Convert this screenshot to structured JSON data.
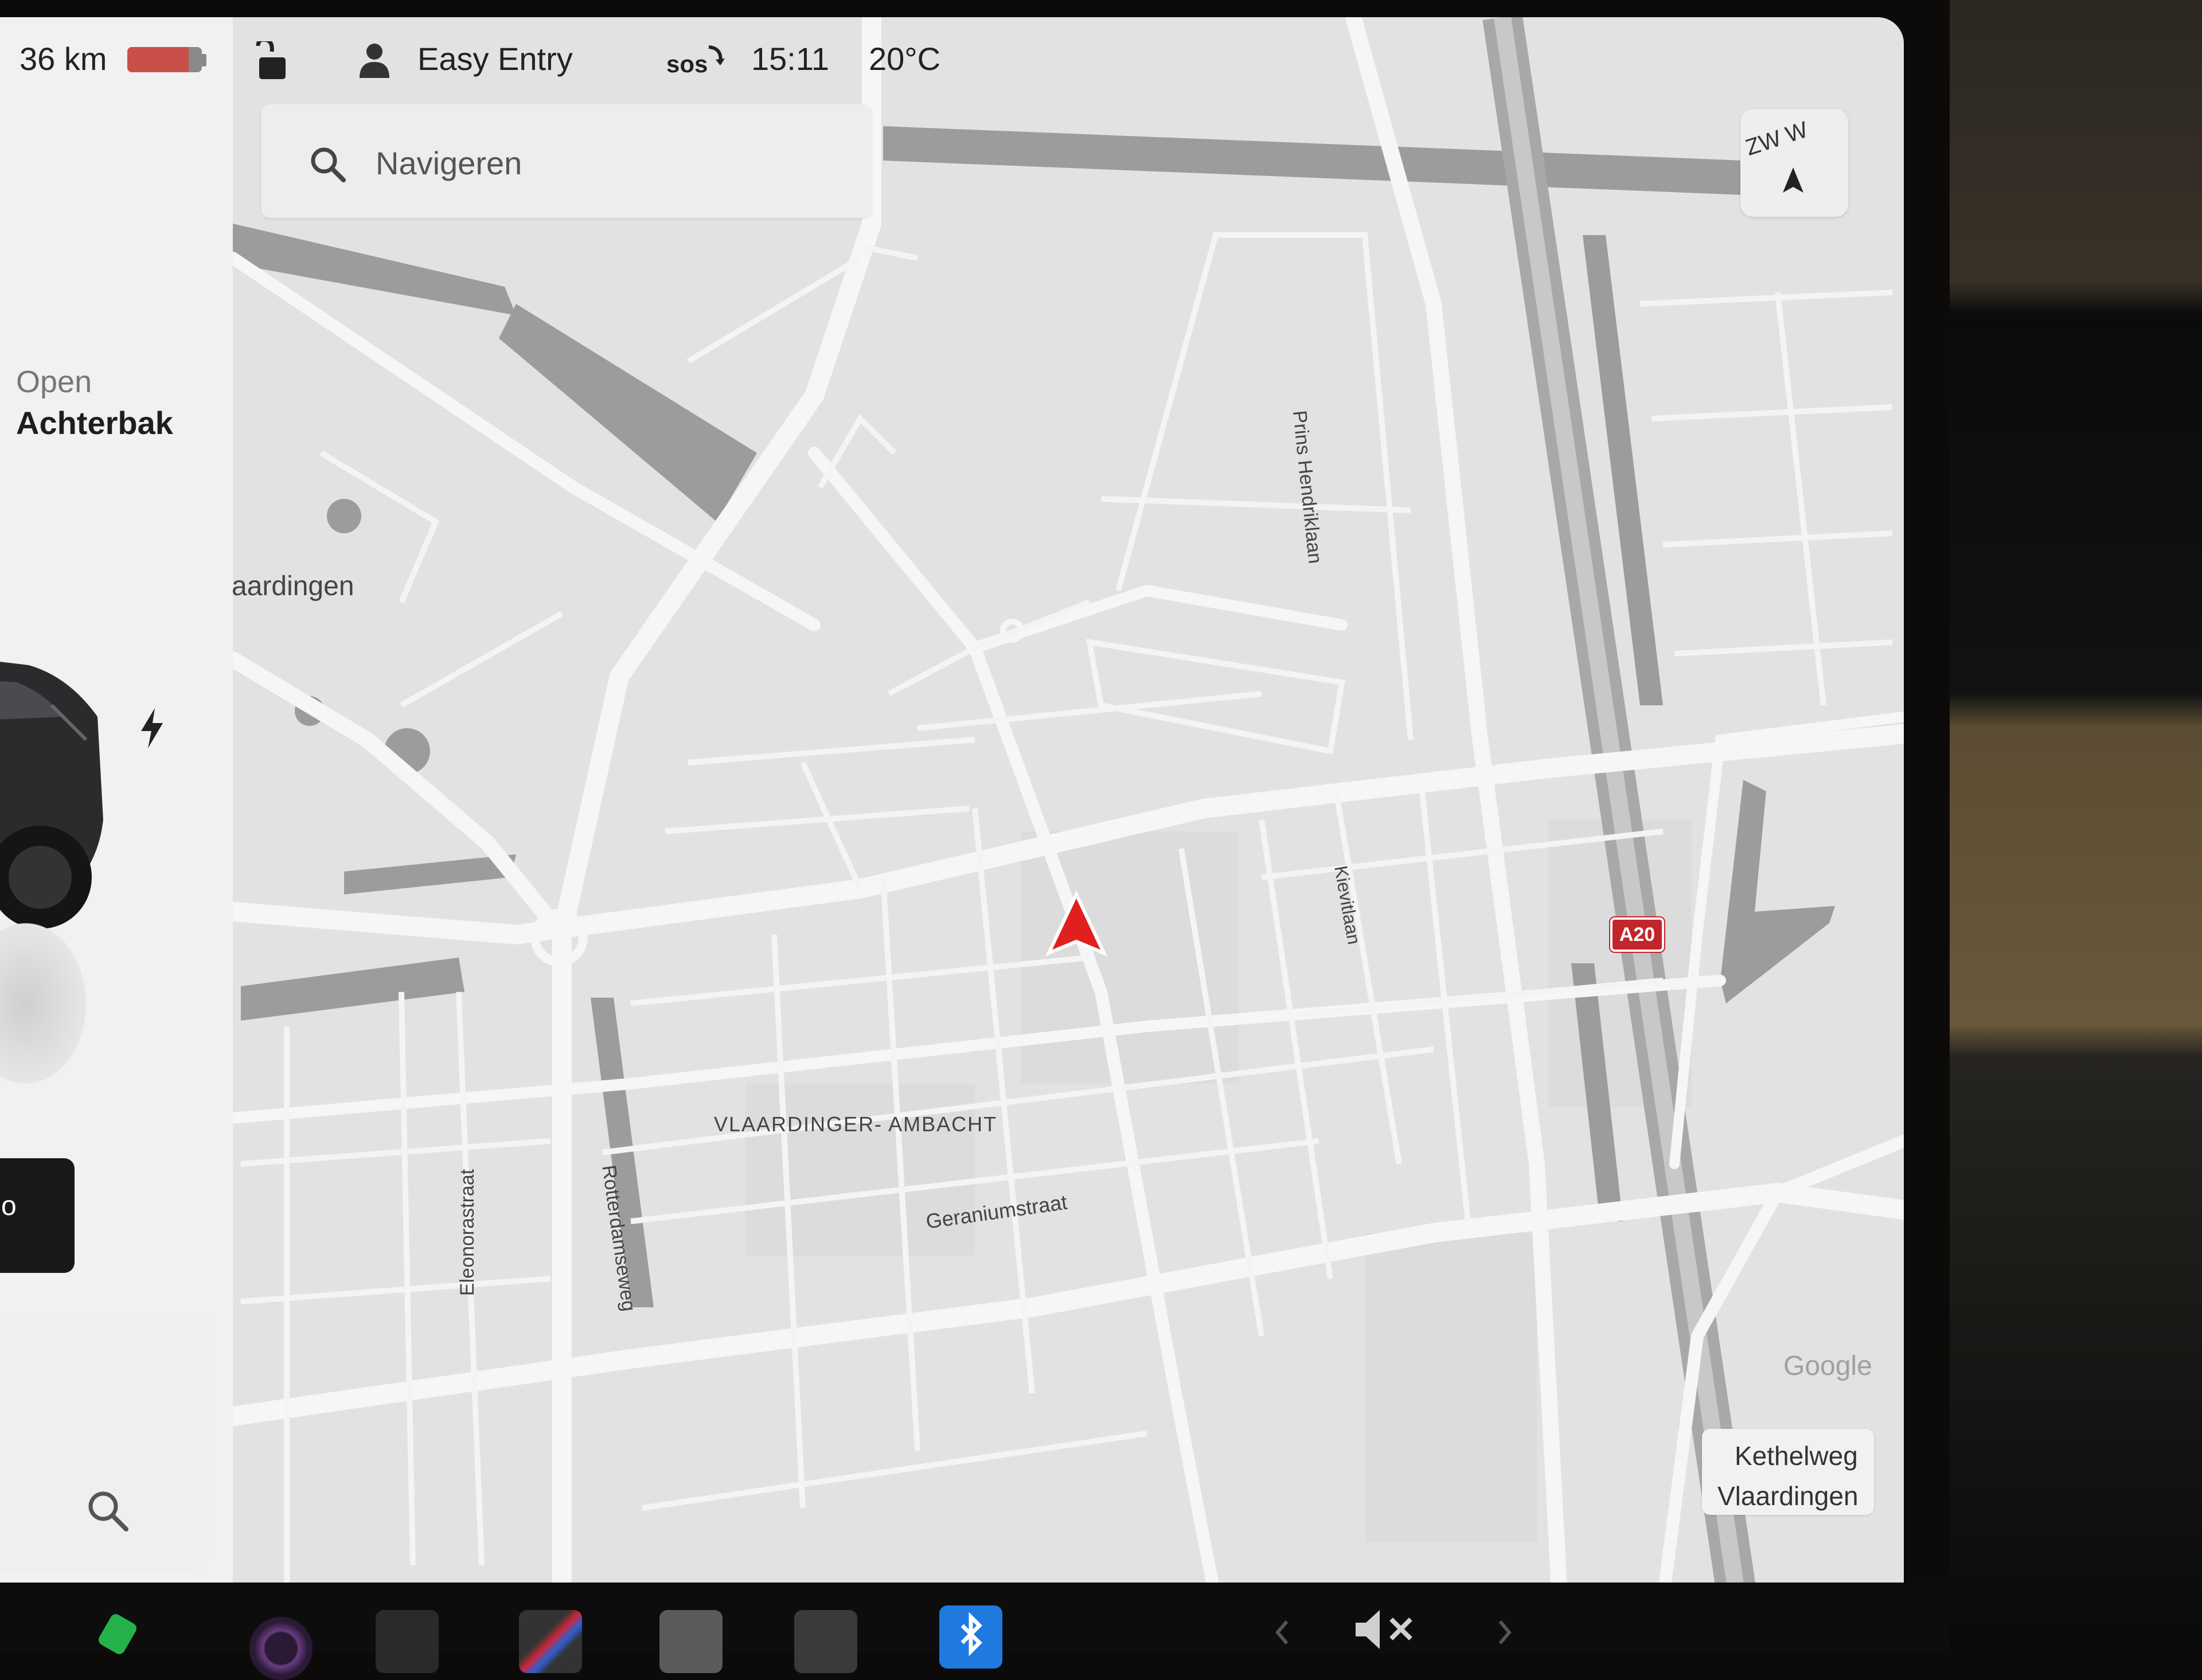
{
  "status_bar": {
    "range": "36 km",
    "battery_level_fraction": 0.82,
    "driver_profile": "Easy Entry",
    "sos_label": "sos",
    "time": "15:11",
    "temperature": "20°C",
    "lock_icon": "unlocked-lock-icon",
    "profile_icon": "person-icon"
  },
  "left_panel": {
    "trunk_action": "Open",
    "trunk_label": "Achterbak",
    "dark_button_label": "o"
  },
  "search": {
    "placeholder": "Navigeren",
    "icon": "search-icon"
  },
  "compass": {
    "heading_text": "ZW W"
  },
  "map": {
    "labels": {
      "city": "aardingen",
      "street_prins": "Prins Hendriklaan",
      "street_kievit": "Kievitlaan",
      "district": "VLAARDINGER- AMBACHT",
      "street_geranium": "Geraniumstraat",
      "street_eleonora": "Eleonorastraat",
      "street_rotterdamse": "Rotterdamseweg"
    },
    "highway_shield": "A20",
    "attribution": "Google",
    "current_location": {
      "street": "Kethelweg",
      "city": "Vlaardingen"
    },
    "colors": {
      "background": "#e4e4e4",
      "road": "#f7f7f7",
      "water": "#9a9a9a",
      "nav_arrow": "#e0201d",
      "shield": "#c2252c"
    }
  },
  "taskbar": {
    "icons": [
      "phone-icon",
      "camera-app-icon",
      "media-icon",
      "browser-icon",
      "info-icon",
      "dashcam-icon",
      "bluetooth-icon",
      "prev-chevron-icon",
      "mute-icon",
      "next-chevron-icon"
    ]
  }
}
